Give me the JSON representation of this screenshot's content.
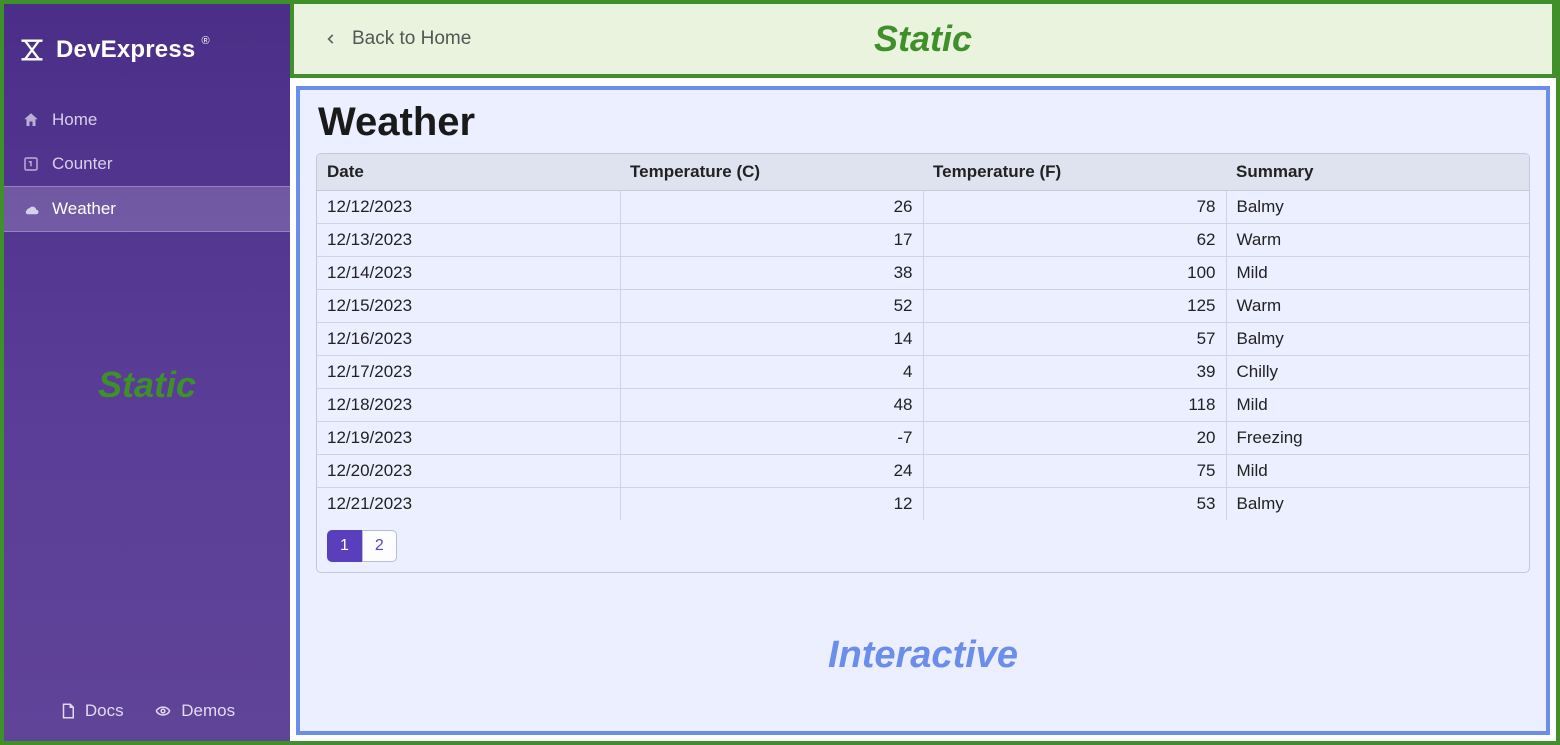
{
  "brand": {
    "name": "DevExpress",
    "reg": "®"
  },
  "sidebar": {
    "items": [
      {
        "label": "Home",
        "icon": "home-icon",
        "active": false
      },
      {
        "label": "Counter",
        "icon": "counter-icon",
        "active": false
      },
      {
        "label": "Weather",
        "icon": "weather-icon",
        "active": true
      }
    ],
    "overlay_label": "Static",
    "bottom": {
      "docs": {
        "label": "Docs",
        "icon": "docs-icon"
      },
      "demos": {
        "label": "Demos",
        "icon": "demos-icon"
      }
    }
  },
  "topbar": {
    "back_label": "Back to Home",
    "overlay_label": "Static"
  },
  "main": {
    "title": "Weather",
    "columns": [
      "Date",
      "Temperature (C)",
      "Temperature (F)",
      "Summary"
    ],
    "rows": [
      {
        "date": "12/12/2023",
        "tc": "26",
        "tf": "78",
        "summary": "Balmy"
      },
      {
        "date": "12/13/2023",
        "tc": "17",
        "tf": "62",
        "summary": "Warm"
      },
      {
        "date": "12/14/2023",
        "tc": "38",
        "tf": "100",
        "summary": "Mild"
      },
      {
        "date": "12/15/2023",
        "tc": "52",
        "tf": "125",
        "summary": "Warm"
      },
      {
        "date": "12/16/2023",
        "tc": "14",
        "tf": "57",
        "summary": "Balmy"
      },
      {
        "date": "12/17/2023",
        "tc": "4",
        "tf": "39",
        "summary": "Chilly"
      },
      {
        "date": "12/18/2023",
        "tc": "48",
        "tf": "118",
        "summary": "Mild"
      },
      {
        "date": "12/19/2023",
        "tc": "-7",
        "tf": "20",
        "summary": "Freezing"
      },
      {
        "date": "12/20/2023",
        "tc": "24",
        "tf": "75",
        "summary": "Mild"
      },
      {
        "date": "12/21/2023",
        "tc": "12",
        "tf": "53",
        "summary": "Balmy"
      }
    ],
    "pager": {
      "pages": [
        "1",
        "2"
      ],
      "active": "1"
    },
    "overlay_label": "Interactive"
  },
  "colors": {
    "static_border": "#3f8f2a",
    "interactive_border": "#6a8eea",
    "sidebar_bg": "#5a3d97",
    "accent": "#5a3fbd"
  }
}
